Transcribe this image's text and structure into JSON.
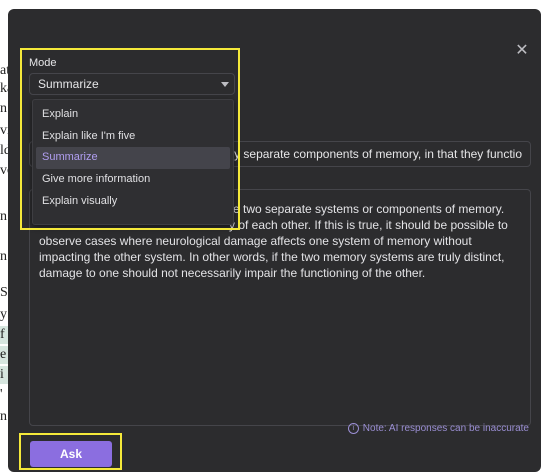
{
  "background_doc": {
    "lines": [
      "at",
      "ka",
      "n",
      "vi",
      "ld",
      "ve",
      "n",
      "n",
      "S",
      "y",
      "f",
      "e",
      "i",
      "'",
      "n"
    ]
  },
  "modal": {
    "close_label": "✕",
    "mode": {
      "label": "Mode",
      "selected": "Summarize",
      "options": [
        "Explain",
        "Explain like I'm five",
        "Summarize",
        "Give more information",
        "Explain visually"
      ]
    },
    "question_value": "y separate components of memory, in that they functio",
    "answer_visible_tail": "re two separate systems or components of memory.",
    "answer_line2_tail": "y of each other. If this is true, it should be possible to",
    "answer_lines": [
      "observe cases where neurological damage affects one system of memory without",
      "impacting the other system. In other words, if the two memory systems are truly distinct,",
      "damage to one should not necessarily impair the functioning of the other."
    ],
    "note": "Note: AI responses can be inaccurate",
    "note_icon": "i",
    "ask_label": "Ask"
  },
  "colors": {
    "modal_bg": "#2c2c2e",
    "accent": "#8b6ee0",
    "highlight_box": "#f5e93a",
    "selected_text": "#b09ef0"
  }
}
